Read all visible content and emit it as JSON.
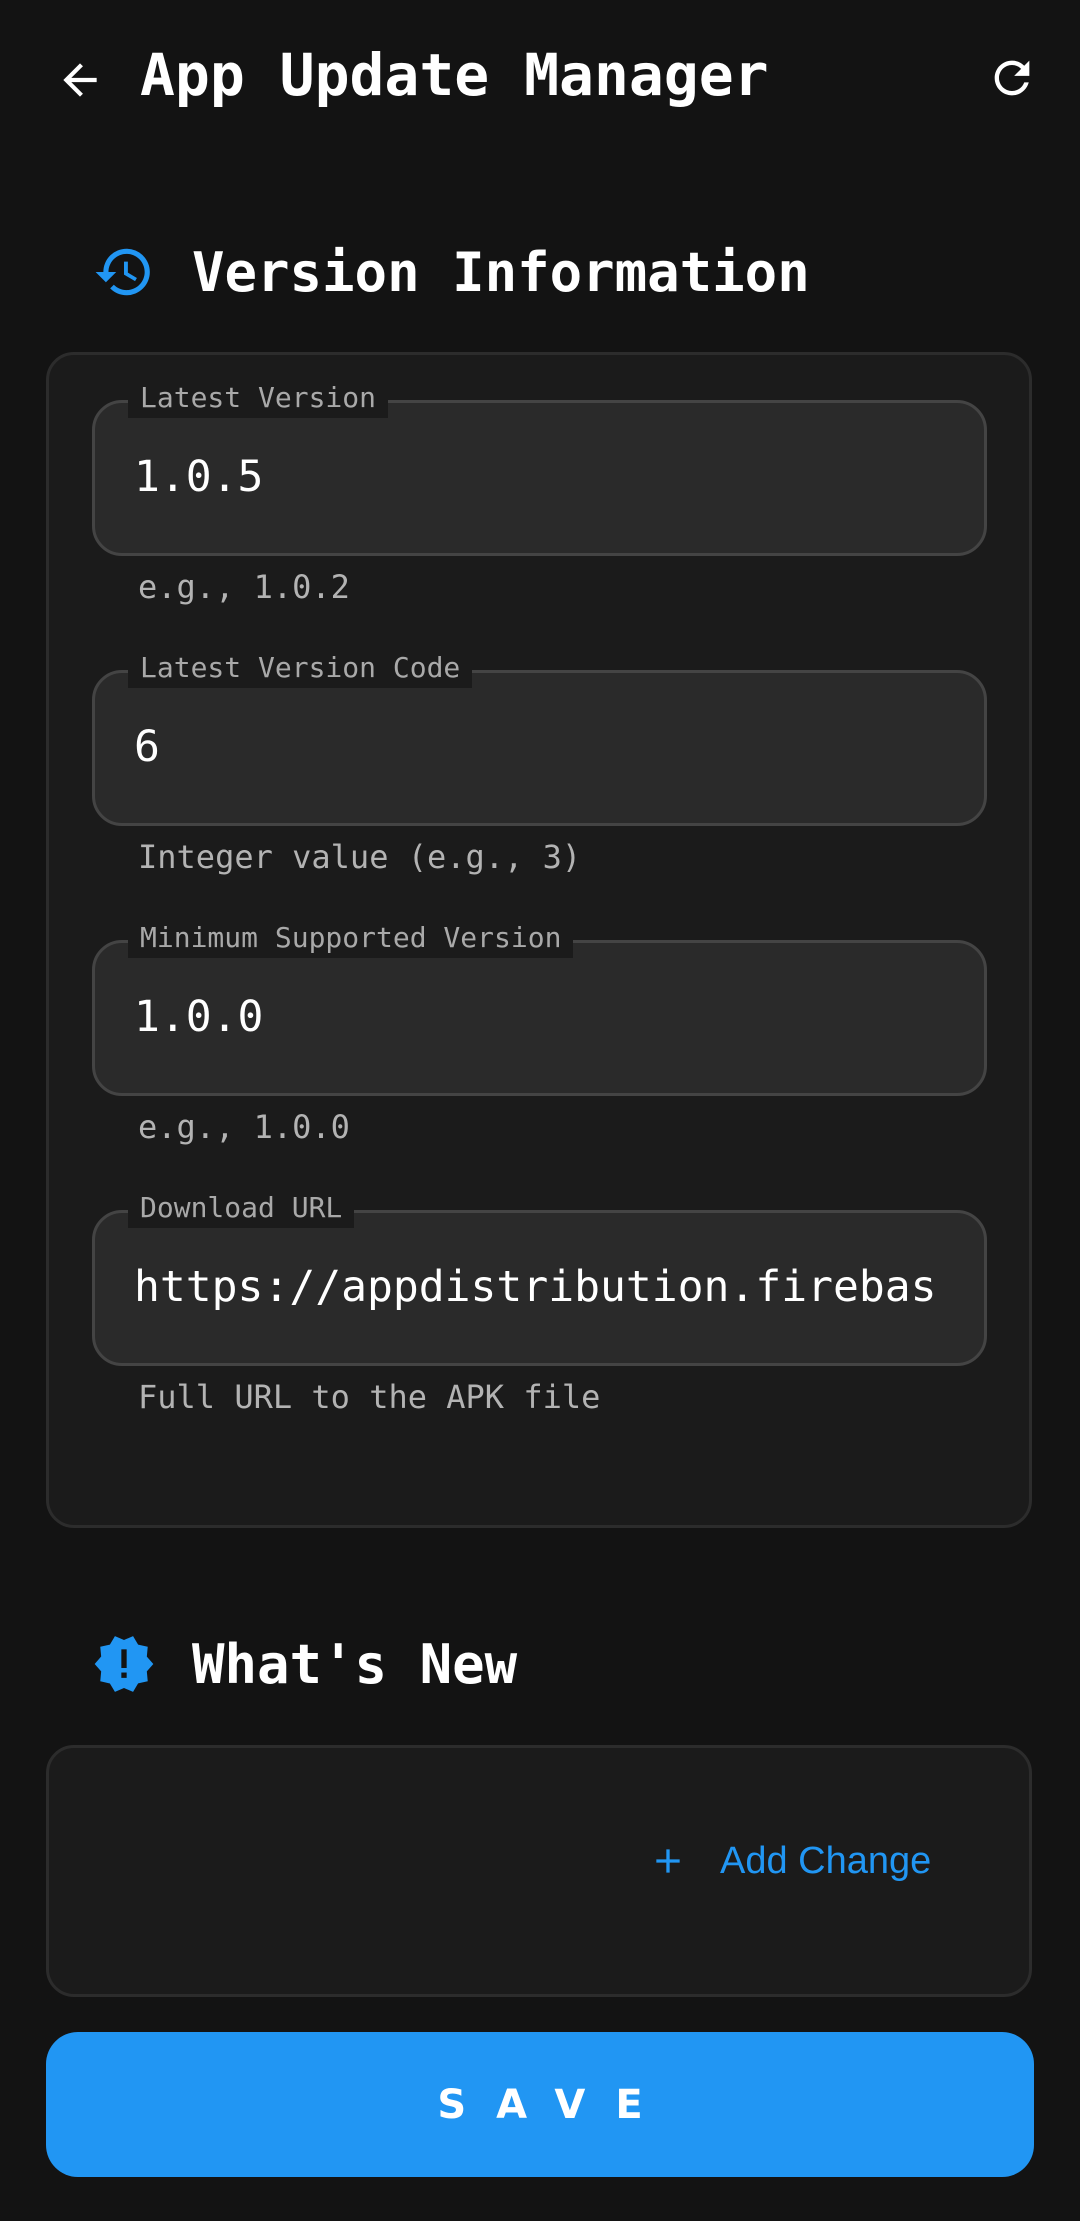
{
  "app_bar": {
    "title": "App Update Manager",
    "back_icon": "arrow-left-icon",
    "refresh_icon": "refresh-icon"
  },
  "version_section": {
    "title": "Version Information",
    "icon": "history-clock-icon",
    "fields": [
      {
        "label": "Latest Version",
        "value": "1.0.5",
        "helper": "e.g., 1.0.2"
      },
      {
        "label": "Latest Version Code",
        "value": "6",
        "helper": "Integer value (e.g., 3)"
      },
      {
        "label": "Minimum Supported Version",
        "value": "1.0.0",
        "helper": "e.g., 1.0.0"
      },
      {
        "label": "Download URL",
        "value": "https://appdistribution.firebas",
        "helper": "Full URL to the APK file"
      }
    ]
  },
  "whats_new_section": {
    "title": "What's New",
    "icon": "alert-badge-icon",
    "add_label": "Add Change"
  },
  "save_label": "SAVE",
  "colors": {
    "background": "#131313",
    "card": "#1b1b1b",
    "input": "#2a2a2a",
    "accent": "#2196f3"
  }
}
